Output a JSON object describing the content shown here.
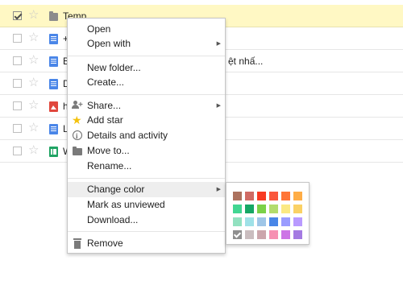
{
  "files": [
    {
      "name": "Temp",
      "type": "folder",
      "selected": true,
      "checked": true
    },
    {
      "name": "+",
      "type": "doc",
      "selected": false,
      "checked": false
    },
    {
      "name": "B",
      "type": "doc",
      "selected": false,
      "checked": false
    },
    {
      "name": "D",
      "type": "doc",
      "selected": false,
      "checked": false
    },
    {
      "name": "h",
      "type": "image",
      "selected": false,
      "checked": false
    },
    {
      "name": "L",
      "type": "doc",
      "selected": false,
      "checked": false
    },
    {
      "name": "W",
      "type": "sheet",
      "selected": false,
      "checked": false
    }
  ],
  "row_trailing_text": "ệt nhấ...",
  "menu": {
    "open": "Open",
    "open_with": "Open with",
    "new_folder": "New folder...",
    "create": "Create...",
    "share": "Share...",
    "add_star": "Add star",
    "details": "Details and activity",
    "move_to": "Move to...",
    "rename": "Rename...",
    "change_color": "Change color",
    "mark_unviewed": "Mark as unviewed",
    "download": "Download...",
    "remove": "Remove"
  },
  "palette_colors": [
    [
      "#ac725e",
      "#d06b64",
      "#f83a22",
      "#fa573c",
      "#ff7537",
      "#ffad46"
    ],
    [
      "#42d692",
      "#16a765",
      "#7bd148",
      "#b3dc6c",
      "#fbe983",
      "#fad165"
    ],
    [
      "#92e1c0",
      "#9fe1e7",
      "#9fc6e7",
      "#4986e7",
      "#9a9cff",
      "#b99aff"
    ],
    [
      "#8f8f8f",
      "#cabdbf",
      "#cca6ac",
      "#f691b2",
      "#cd74e6",
      "#a47ae2"
    ]
  ],
  "palette_selected": "#8f8f8f"
}
